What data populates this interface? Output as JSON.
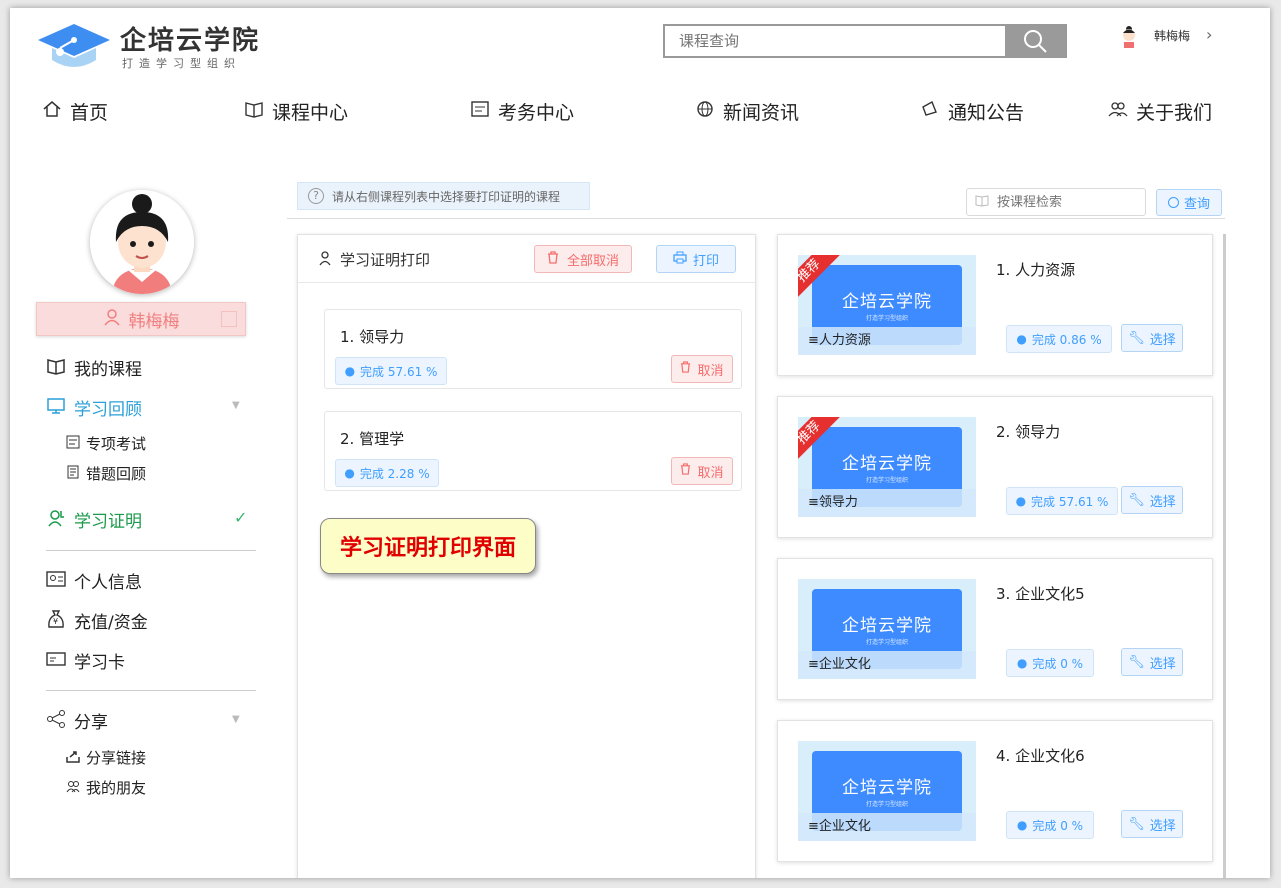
{
  "header": {
    "logo_title": "企培云学院",
    "logo_subtitle": "打造学习型组织",
    "search_placeholder": "课程查询",
    "user_name": "韩梅梅",
    "user_chevron": "›"
  },
  "nav": [
    {
      "label": "首页",
      "icon": "home-icon"
    },
    {
      "label": "课程中心",
      "icon": "book-icon"
    },
    {
      "label": "考务中心",
      "icon": "exam-icon"
    },
    {
      "label": "新闻资讯",
      "icon": "globe-icon"
    },
    {
      "label": "通知公告",
      "icon": "megaphone-icon"
    },
    {
      "label": "关于我们",
      "icon": "people-icon"
    }
  ],
  "sidebar": {
    "user_name": "韩梅梅",
    "items": [
      {
        "label": "我的课程"
      },
      {
        "label": "学习回顾"
      },
      {
        "label": "专项考试"
      },
      {
        "label": "错题回顾"
      },
      {
        "label": "学习证明"
      },
      {
        "label": "个人信息"
      },
      {
        "label": "充值/资金"
      },
      {
        "label": "学习卡"
      },
      {
        "label": "分享"
      },
      {
        "label": "分享链接"
      },
      {
        "label": "我的朋友"
      }
    ]
  },
  "toolbar": {
    "tip": "请从右侧课程列表中选择要打印证明的课程",
    "search_placeholder": "按课程检索",
    "query_label": "查询"
  },
  "print_panel": {
    "title": "学习证明打印",
    "cancel_all_label": "全部取消",
    "print_label": "打印",
    "selected": [
      {
        "title": "1. 领导力",
        "progress": "完成 57.61 %",
        "cancel_label": "取消"
      },
      {
        "title": "2. 管理学",
        "progress": "完成 2.28 %",
        "cancel_label": "取消"
      }
    ]
  },
  "callout": "学习证明打印界面",
  "courses": [
    {
      "title": "1. 人力资源",
      "thumb_label": "人力资源",
      "badge": "推荐",
      "progress": "完成 0.86 %",
      "select_label": "选择",
      "thumb_logo": "企培云学院",
      "thumb_sub": "打造学习型组织"
    },
    {
      "title": "2. 领导力",
      "thumb_label": "领导力",
      "badge": "推荐",
      "progress": "完成 57.61 %",
      "select_label": "选择",
      "thumb_logo": "企培云学院",
      "thumb_sub": "打造学习型组织"
    },
    {
      "title": "3. 企业文化5",
      "thumb_label": "企业文化",
      "badge": "",
      "progress": "完成 0 %",
      "select_label": "选择",
      "thumb_logo": "企培云学院",
      "thumb_sub": "打造学习型组织"
    },
    {
      "title": "4. 企业文化6",
      "thumb_label": "企业文化",
      "badge": "",
      "progress": "完成 0 %",
      "select_label": "选择",
      "thumb_logo": "企培云学院",
      "thumb_sub": "打造学习型组织"
    }
  ],
  "colors": {
    "accent": "#409eff",
    "active_green": "#1a9a4a",
    "active_blue": "#2a9fd8",
    "danger": "#f56c6c"
  }
}
